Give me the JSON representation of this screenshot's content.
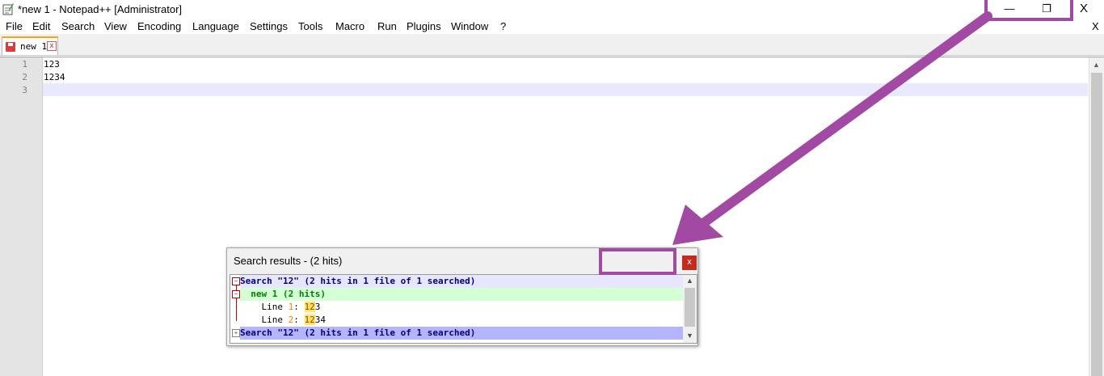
{
  "window": {
    "title": "*new 1 - Notepad++ [Administrator]",
    "minimize_glyph": "—",
    "maximize_glyph": "❐",
    "close_glyph": "X"
  },
  "menu": {
    "items": [
      "File",
      "Edit",
      "Search",
      "View",
      "Encoding",
      "Language",
      "Settings",
      "Tools",
      "Macro",
      "Run",
      "Plugins",
      "Window",
      "?"
    ],
    "close_doc": "X"
  },
  "tabs": [
    {
      "label": "new 1",
      "close_glyph": "x"
    }
  ],
  "editor": {
    "line_numbers": [
      "1",
      "2",
      "3"
    ],
    "lines": [
      "123",
      "1234",
      ""
    ]
  },
  "search_panel": {
    "title": "Search results - (2 hits)",
    "close_glyph": "x",
    "results": {
      "header1": "Search \"12\" (2 hits in 1 file of 1 searched)",
      "file_entry": "new 1 (2 hits)",
      "hits": [
        {
          "label": "Line ",
          "num": "1",
          "sep": ": ",
          "match": "12",
          "rest": "3"
        },
        {
          "label": "Line ",
          "num": "2",
          "sep": ": ",
          "match": "12",
          "rest": "34"
        }
      ],
      "header2": "Search \"12\" (2 hits in 1 file of 1 searched)"
    }
  },
  "colors": {
    "annotation": "#a24aa3",
    "tab_accent": "#f9a21b",
    "panel_close_bg": "#c42b1c"
  }
}
